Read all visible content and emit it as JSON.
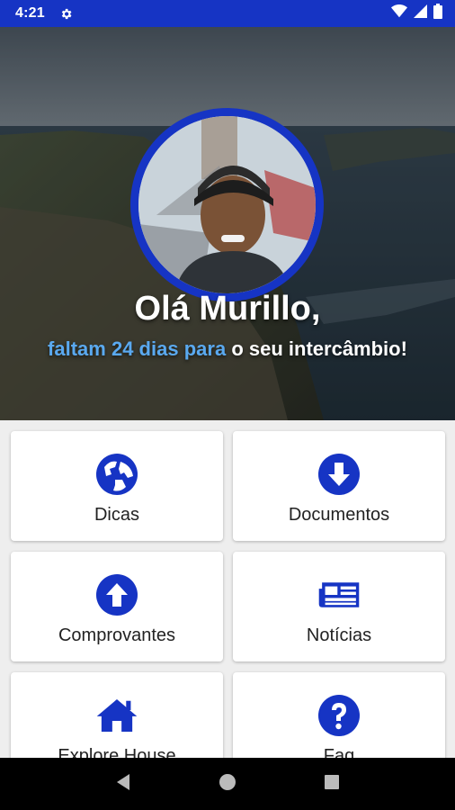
{
  "status_bar": {
    "time": "4:21"
  },
  "profile": {
    "greeting": "Olá Murillo,",
    "countdown": {
      "part1": "faltam",
      "days": "24 dias",
      "part2": "para",
      "part3": "o",
      "part4": "seu intercâmbio!"
    }
  },
  "menu": [
    {
      "label": "Dicas",
      "icon": "globe-icon"
    },
    {
      "label": "Documentos",
      "icon": "download-icon"
    },
    {
      "label": "Comprovantes",
      "icon": "upload-icon"
    },
    {
      "label": "Notícias",
      "icon": "newspaper-icon"
    },
    {
      "label": "Explore House",
      "icon": "home-icon"
    },
    {
      "label": "Faq",
      "icon": "question-icon"
    }
  ],
  "colors": {
    "primary": "#1634c4",
    "highlight": "#5aa9f0"
  }
}
